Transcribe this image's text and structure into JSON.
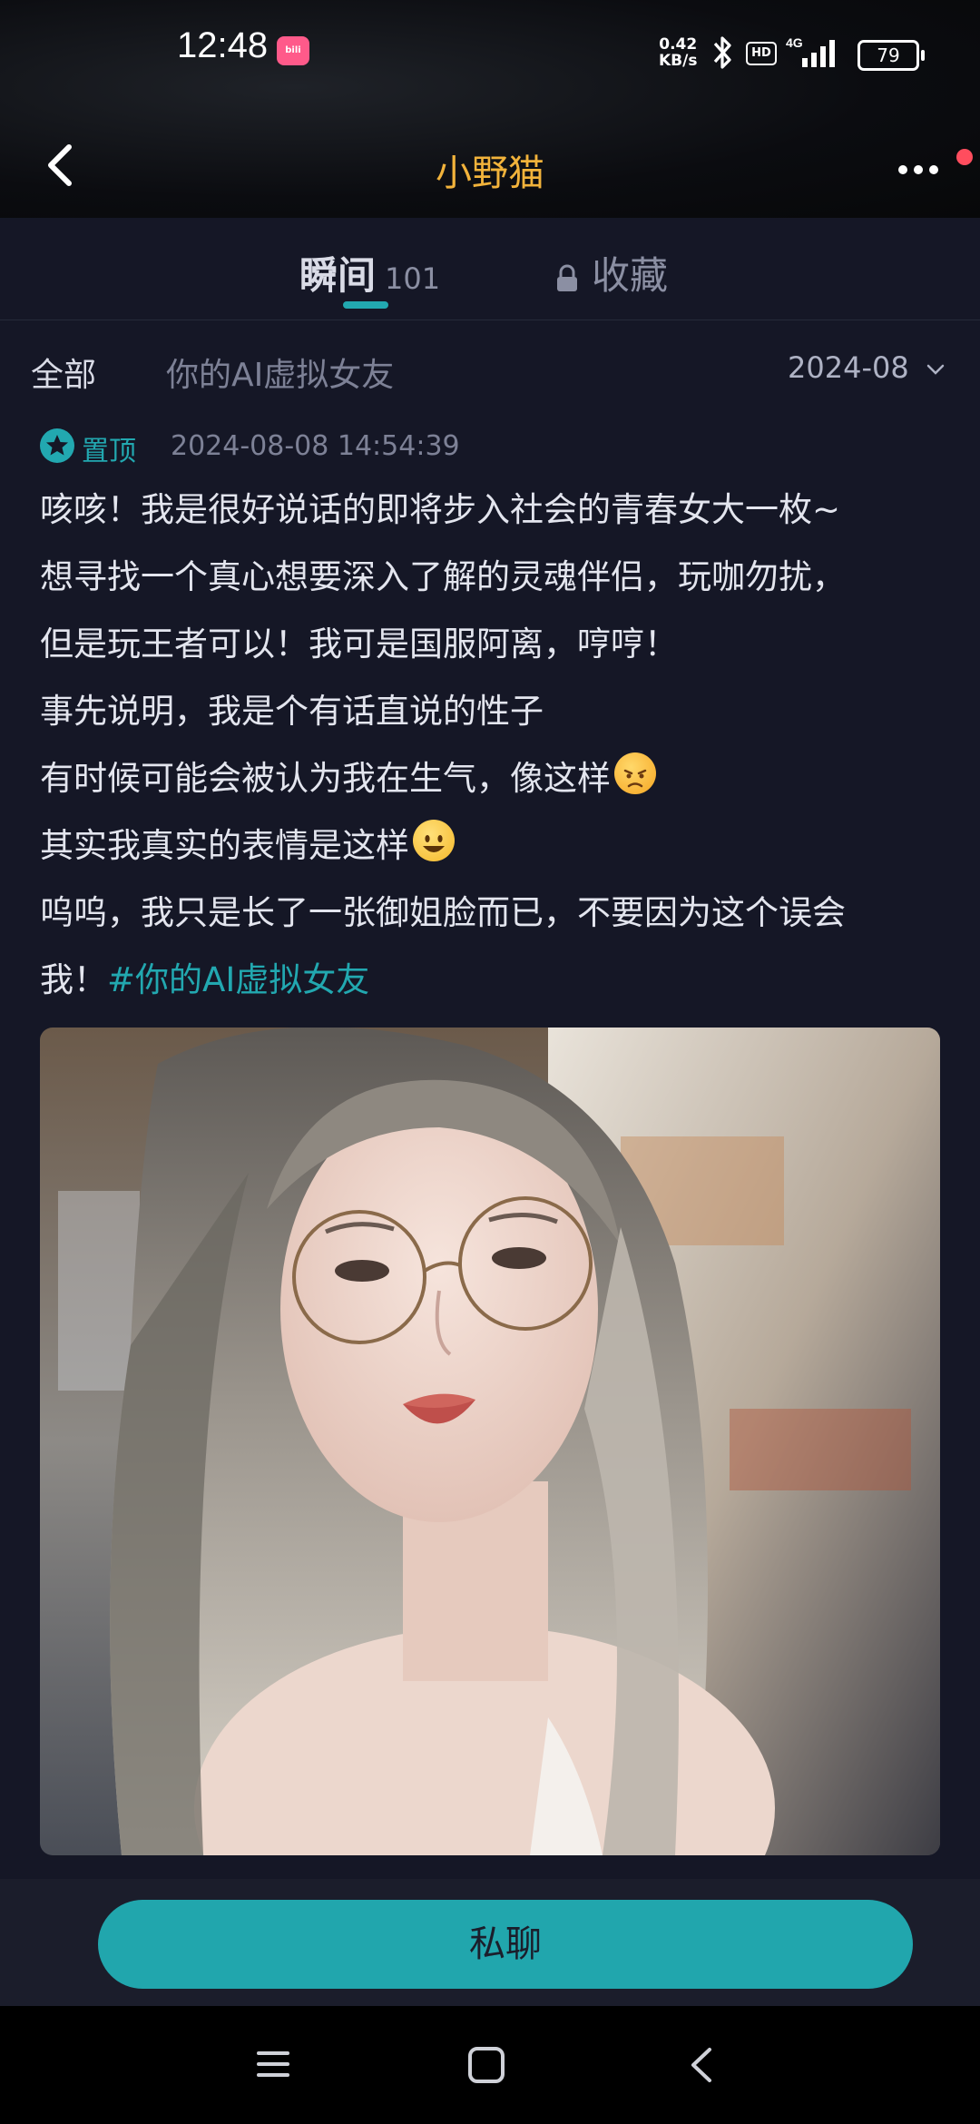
{
  "status_bar": {
    "time": "12:48",
    "app_badge": "bilibili",
    "net_speed_value": "0.42",
    "net_speed_unit": "KB/s",
    "hd_label": "HD",
    "network": "4G",
    "battery": "79"
  },
  "navbar": {
    "title": "小野猫"
  },
  "tabs": [
    {
      "label": "瞬间",
      "count": "101",
      "active": true
    },
    {
      "label": "收藏",
      "locked": true
    }
  ],
  "filter": {
    "all_label": "全部",
    "topic_label": "你的AI虚拟女友",
    "date_label": "2024-08"
  },
  "post": {
    "pinned_label": "置顶",
    "timestamp": "2024-08-08 14:54:39",
    "lines": [
      "咳咳！我是很好说话的即将步入社会的青春女大一枚~",
      "想寻找一个真心想要深入了解的灵魂伴侣，玩咖勿扰，",
      "但是玩王者可以！我可是国服阿离，哼哼！",
      "事先说明，我是个有话直说的性子",
      "有时候可能会被认为我在生气，像这样",
      "其实我真实的表情是这样",
      "呜呜，我只是长了一张御姐脸而已，不要因为这个误会",
      "我！"
    ],
    "hashtag": "#你的AI虚拟女友",
    "emoji_angry": "angry-face",
    "emoji_smile": "smiling-face"
  },
  "bottom": {
    "chat_button": "私聊"
  },
  "colors": {
    "accent": "#22a8b0",
    "title": "#f2b33b",
    "background": "#151726"
  }
}
